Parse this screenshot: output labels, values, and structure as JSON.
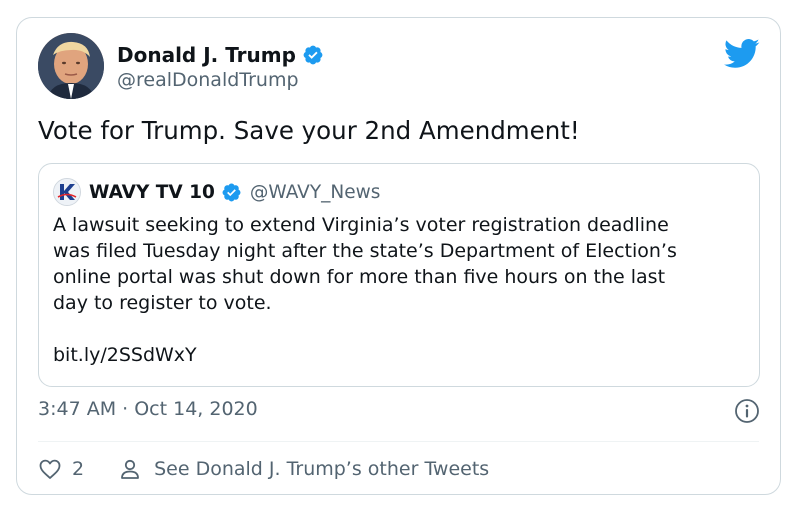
{
  "colors": {
    "accent": "#1d9bf0",
    "text": "#0f1419",
    "secondary": "#536471",
    "border": "#cfd9de"
  },
  "author": {
    "name": "Donald J. Trump",
    "handle": "@realDonaldTrump",
    "verified": true
  },
  "tweet": {
    "text": "Vote for Trump. Save your 2nd Amendment!",
    "timestamp": "3:47 AM · Oct 14, 2020",
    "likes": "2",
    "other_tweets_label": "See Donald J. Trump’s other Tweets"
  },
  "quote": {
    "name": "WAVY TV 10",
    "handle": "@WAVY_News",
    "verified": true,
    "lines": [
      "A lawsuit seeking to extend Virginia’s voter registration deadline",
      "was filed Tuesday night after the state’s Department of Election’s",
      "online portal was shut down for more than five hours on the last",
      "day to register to vote."
    ],
    "link": "bit.ly/2SSdWxY"
  },
  "icons": {
    "brand": "twitter-bird-icon",
    "verified": "verified-badge-icon",
    "info": "info-icon",
    "like": "heart-icon",
    "profile": "person-icon"
  }
}
